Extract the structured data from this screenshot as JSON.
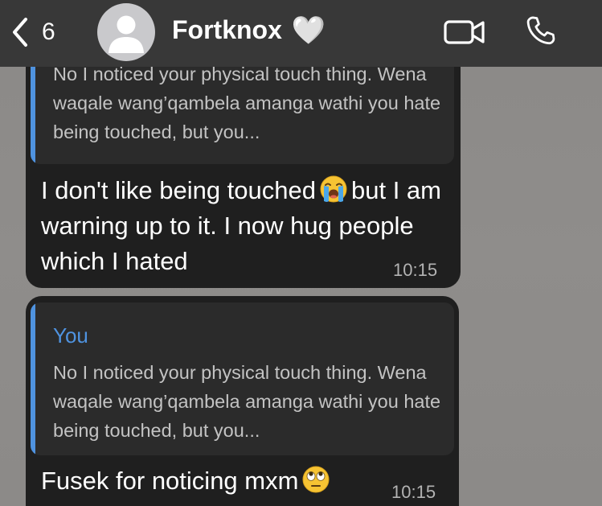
{
  "header": {
    "back_count": "6",
    "contact_name": "Fortknox",
    "name_emoji": "🤍"
  },
  "messages": [
    {
      "quote_text": "No I noticed your physical touch thing. Wena waqale wang’qambela amanga wathi you hate being touched, but you...",
      "text_before_emoji": "I don't like being touched",
      "emoji_icon": "loudly-crying-face-icon",
      "text_after_emoji": "but I am warning up to it. I now hug people which I hated",
      "time": "10:15"
    },
    {
      "quote_sender": "You",
      "quote_text": "No I noticed your physical touch thing. Wena waqale wang’qambela amanga wathi you hate being touched, but you...",
      "text_before_emoji": "Fusek for noticing mxm",
      "emoji_icon": "face-with-rolling-eyes-icon",
      "time": "10:15"
    }
  ],
  "colors": {
    "header_bg": "#383838",
    "bubble_bg": "#1f1f1f",
    "quote_bg": "#2b2b2b",
    "quote_accent": "#4f93e0",
    "wallpaper": "#8f8d8a"
  }
}
